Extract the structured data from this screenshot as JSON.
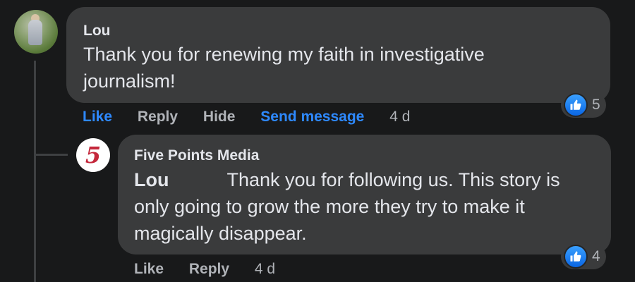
{
  "comment": {
    "author": "Lou",
    "text": "Thank you for renewing my faith in investigative journalism!",
    "actions": {
      "like": "Like",
      "reply": "Reply",
      "hide": "Hide",
      "send_message": "Send message",
      "time": "4 d"
    },
    "reaction_count": "5"
  },
  "reply": {
    "author": "Five Points Media",
    "avatar_glyph": "5",
    "mention": "Lou",
    "text": "Thank you for following us. This story is only going to grow the more they try to make it magically disappear.",
    "actions": {
      "like": "Like",
      "reply": "Reply",
      "time": "4 d"
    },
    "reaction_count": "4"
  },
  "colors": {
    "background": "#18191a",
    "bubble": "#3a3b3c",
    "link_blue": "#2e89ff",
    "secondary_text": "#b0b3b8"
  },
  "icons": {
    "reaction": "thumbs-up-icon"
  }
}
